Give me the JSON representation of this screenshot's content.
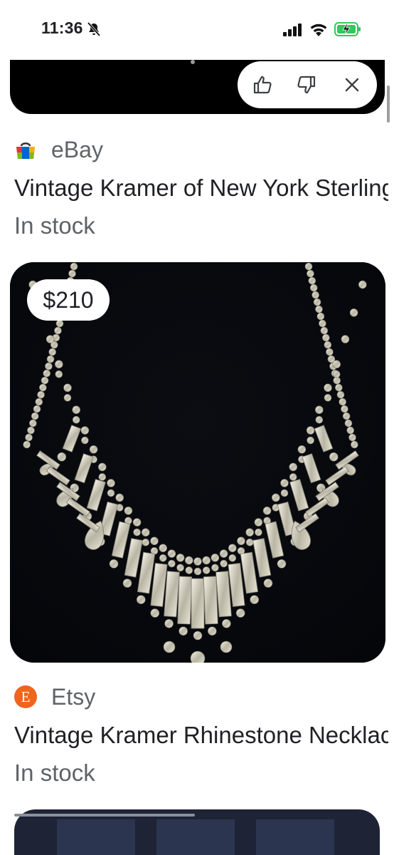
{
  "status_bar": {
    "time": "11:36",
    "icons": [
      "bell-slash-icon",
      "signal-icon",
      "wifi-icon",
      "battery-charging-icon"
    ],
    "battery_color": "#34c759"
  },
  "top_card": {
    "feedback": {
      "like_icon": "thumb-up-icon",
      "dislike_icon": "thumb-down-icon",
      "close_icon": "close-icon"
    }
  },
  "listings": [
    {
      "merchant": "eBay",
      "logo_icon": "ebay-bag-icon",
      "title": "Vintage Kramer of New York Sterling",
      "stock": "In stock"
    },
    {
      "merchant": "Etsy",
      "logo_icon": "etsy-e-icon",
      "logo_color": "#f1641e",
      "title": "Vintage Kramer Rhinestone Necklace",
      "stock": "In stock",
      "price": "$210"
    }
  ]
}
